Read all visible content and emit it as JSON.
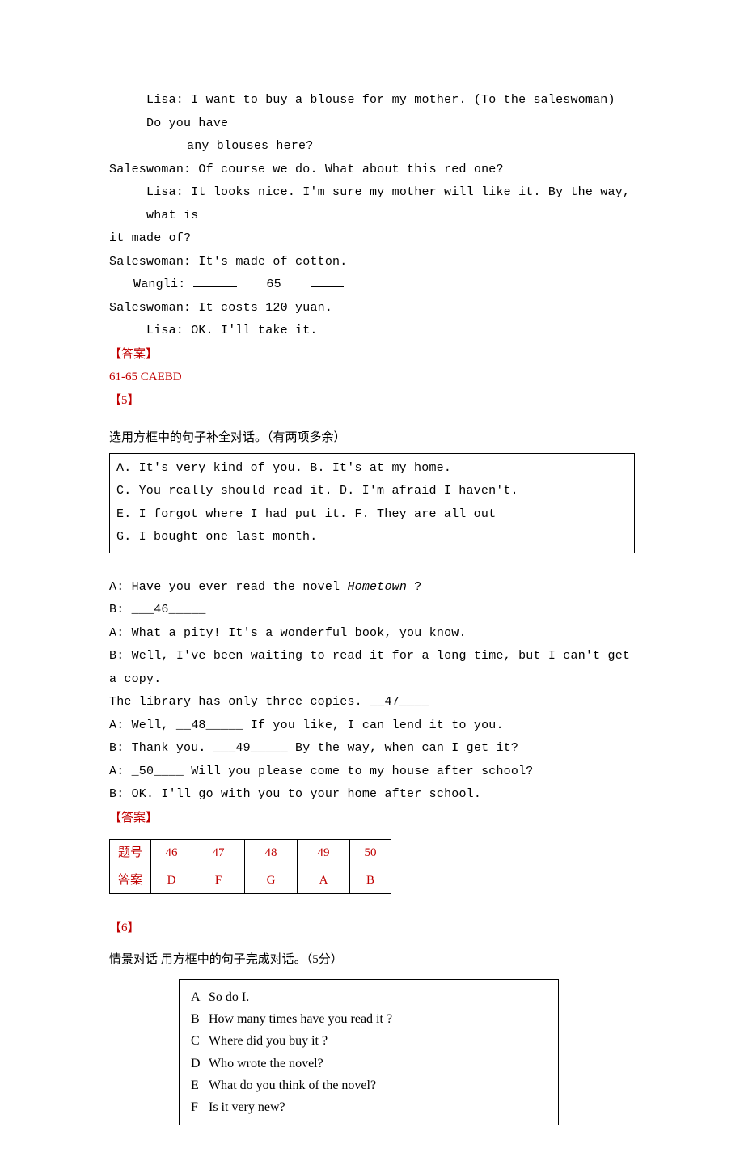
{
  "dialog4": {
    "lisa1a": "Lisa: I want to buy a blouse for my mother. (To the saleswoman) Do you have",
    "lisa1b": "any blouses here?",
    "sw1": "Saleswoman: Of course we do. What about this red one?",
    "lisa2a": "Lisa: It looks nice. I'm sure my mother will like it. By the way, what is",
    "lisa2b": "it made of?",
    "sw2": "Saleswoman: It's made of cotton.",
    "wangli_label": "Wangli: ",
    "blank65": "65",
    "sw3": "Saleswoman: It costs 120 yuan.",
    "lisa3": "Lisa: OK. I'll take it.",
    "ans_label": "【答案】",
    "ans_text": "61-65 CAEBD"
  },
  "section5": {
    "tag": "【5】",
    "instr": "选用方框中的句子补全对话。（有两项多余）",
    "box": {
      "l1": "A. It's very kind of you.    B. It's at my home.",
      "l2": "C. You really should read it.  D. I'm afraid I haven't.",
      "l3": "E. I forgot where I had put it.  F. They are all out",
      "l4": "G. I bought one last month."
    },
    "d": {
      "a1a": "A: Have you ever read the novel ",
      "a1b": "Hometown",
      "a1c": " ?",
      "b1": "B: ___46_____",
      "a2": "A: What a pity! It's a wonderful book, you know.",
      "b2a": "B: Well, I've been waiting to read it for a long time, but I can't get a copy.",
      "b2b": "The library has only three copies. __47____",
      "a3": "A: Well, __48_____ If you like, I can lend it to you.",
      "b3": "B: Thank you. ___49_____ By the way, when can I get it?",
      "a4": "A: _50____ Will you please come to my house after school?",
      "b4": "B: OK. I'll go with you to your home after school."
    },
    "ans_label": "【答案】",
    "table": {
      "h": "题号",
      "c46": "46",
      "c47": "47",
      "c48": "48",
      "c49": "49",
      "c50": "50",
      "a": "答案",
      "v46": "D",
      "v47": "F",
      "v48": "G",
      "v49": "A",
      "v50": "B"
    }
  },
  "section6": {
    "tag": "【6】",
    "instr": "情景对话 用方框中的句子完成对话。（5分）",
    "opts": {
      "A_l": "A",
      "A_t": "So do I.",
      "B_l": "B",
      "B_t": "How many times have you read it ?",
      "C_l": "C",
      "C_t": "Where did you buy it ?",
      "D_l": "D",
      "D_t": "Who wrote the novel?",
      "E_l": "E",
      "E_t": "What do you think of the novel?",
      "F_l": "F",
      "F_t": "Is it very new?"
    }
  }
}
